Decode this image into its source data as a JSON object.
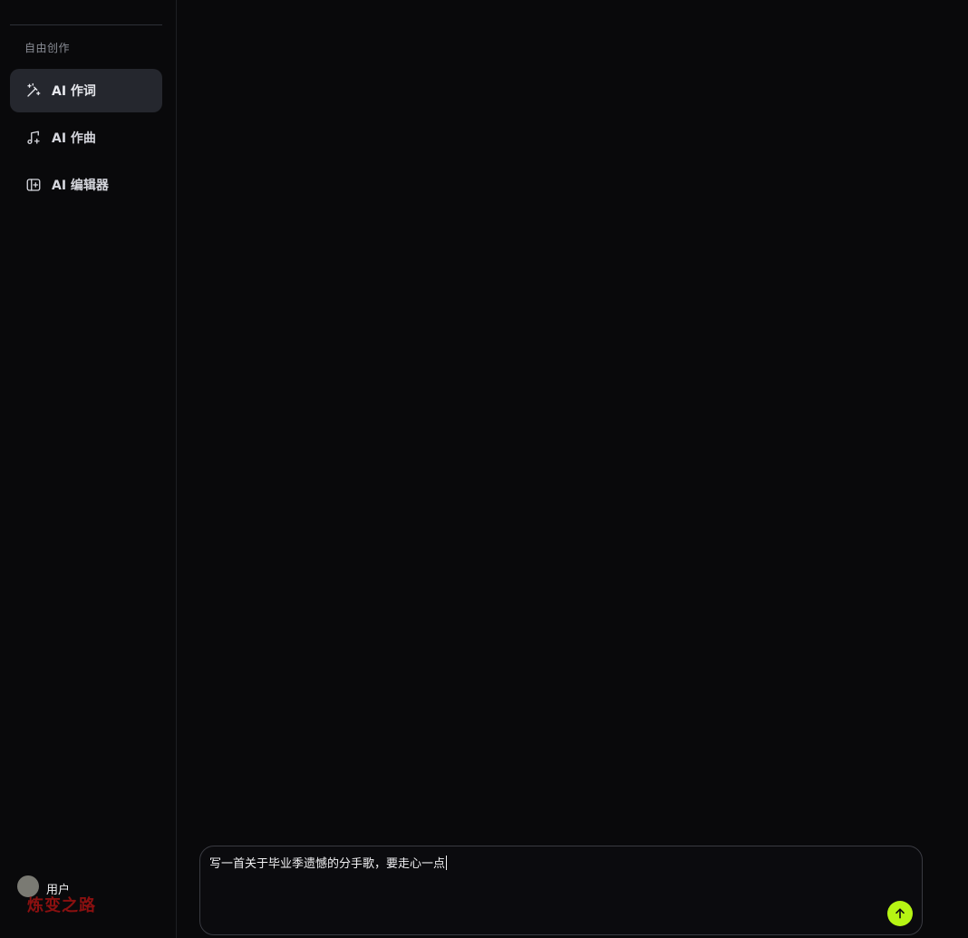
{
  "sidebar": {
    "section_label": "自由创作",
    "items": [
      {
        "label": "AI 作词",
        "icon": "magic-wand-icon",
        "active": true
      },
      {
        "label": "AI 作曲",
        "icon": "music-note-icon",
        "active": false
      },
      {
        "label": "AI 编辑器",
        "icon": "editor-panel-icon",
        "active": false
      }
    ],
    "user": {
      "name": "用户"
    },
    "watermark": "炼变之路"
  },
  "composer": {
    "value": "写一首关于毕业季遗憾的分手歌，要走心一点",
    "send_icon": "arrow-up-icon"
  },
  "colors": {
    "background": "#09090b",
    "active_item": "#25272e",
    "accent": "#b6f514"
  }
}
